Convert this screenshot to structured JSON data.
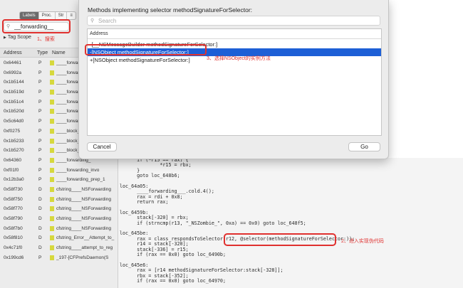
{
  "sidebar": {
    "segments": [
      "Labels",
      "Proc.",
      "Str",
      "≡"
    ],
    "search_value": "__forwarding__",
    "annotation": "1、搜索",
    "tag_scope": "Tag Scope",
    "columns": {
      "address": "Address",
      "type": "Type",
      "name": "Name"
    },
    "rows": [
      {
        "address": "0x64461",
        "type": "P",
        "name": "____forwarding__"
      },
      {
        "address": "0x6992a",
        "type": "P",
        "name": "____forwarding_"
      },
      {
        "address": "0x1b5144",
        "type": "P",
        "name": "____forwarding_"
      },
      {
        "address": "0x1b519d",
        "type": "P",
        "name": "____forwarding_"
      },
      {
        "address": "0x1b51c4",
        "type": "P",
        "name": "____forwarding_"
      },
      {
        "address": "0x1b520d",
        "type": "P",
        "name": "____forwarding_"
      },
      {
        "address": "0x5c64d0",
        "type": "P",
        "name": "____forwarding_"
      },
      {
        "address": "0xf0275",
        "type": "P",
        "name": "____block_forwa"
      },
      {
        "address": "0x1b5233",
        "type": "P",
        "name": "____block_forwa"
      },
      {
        "address": "0x1b5270",
        "type": "P",
        "name": "____block_forwa"
      },
      {
        "address": "0x64360",
        "type": "P",
        "name": "____forwarding_"
      },
      {
        "address": "0xf01f0",
        "type": "P",
        "name": "____forwarding_invo"
      },
      {
        "address": "0x12b3a0",
        "type": "P",
        "name": "____forwarding_prep_1"
      },
      {
        "address": "0x58f730",
        "type": "D",
        "name": "cfstring____NSForwarding"
      },
      {
        "address": "0x58f750",
        "type": "D",
        "name": "cfstring____NSForwarding"
      },
      {
        "address": "0x58f770",
        "type": "D",
        "name": "cfstring____NSForwarding"
      },
      {
        "address": "0x58f790",
        "type": "D",
        "name": "cfstring____NSForwarding"
      },
      {
        "address": "0x58f7b0",
        "type": "D",
        "name": "cfstring____NSForwarding"
      },
      {
        "address": "0x58f810",
        "type": "D",
        "name": "cfstring_Error__Attempt_to_"
      },
      {
        "address": "0x4c71f0",
        "type": "D",
        "name": "cfstring____attempt_to_reg"
      },
      {
        "address": "0x199cd6",
        "type": "P",
        "name": "_197-[CFPrefsDaemon(S"
      }
    ]
  },
  "sheet": {
    "title": "Methods implementing selector methodSignatureForSelector:",
    "search_placeholder": "Search",
    "list_header": "Address",
    "items": [
      "-[__NSMessageBuilder methodSignatureForSelector:]",
      "-[NSObject methodSignatureForSelector:]",
      "+[NSObject methodSignatureForSelector:]"
    ],
    "selected_index": 1,
    "annotation": "3、选择NSObject的实例方法",
    "cancel_label": "Cancel",
    "go_label": "Go"
  },
  "code": {
    "lines": [
      "      if (*r15 == rax) {",
      "              *r15 = rbx;",
      "      }",
      "      goto loc_648b6;",
      "",
      "loc_64a05:",
      "      ____forwarding___.cold.4();",
      "      rax = rdi + 0x8;",
      "      return rax;",
      "",
      "loc_6459b:",
      "      stack[-320] = rbx;",
      "      if (strncmp(r13, \"_NSZombie_\", 0xa) == 0x0) goto loc_648f5;",
      "",
      "loc_645be:",
      "      rax = class_respondsToSelector(r12, @selector(methodSignatureForSelector:));",
      "      r14 = stack[-320];",
      "      stack[-336] = r15;",
      "      if (rax == 0x0) goto loc_6490b;",
      "",
      "loc_645e6:",
      "      rax = [r14 methodSignatureForSelector:stack[-328]];",
      "      rbx = stack[-352];",
      "      if (rax == 0x0) goto loc_64970;"
    ],
    "annotation": "2、进入实现伪代码"
  },
  "colors": {
    "annotation_red": "#e0312f",
    "selection_blue": "#1d5fd6",
    "symbol_swatch": "#d6d83d"
  }
}
